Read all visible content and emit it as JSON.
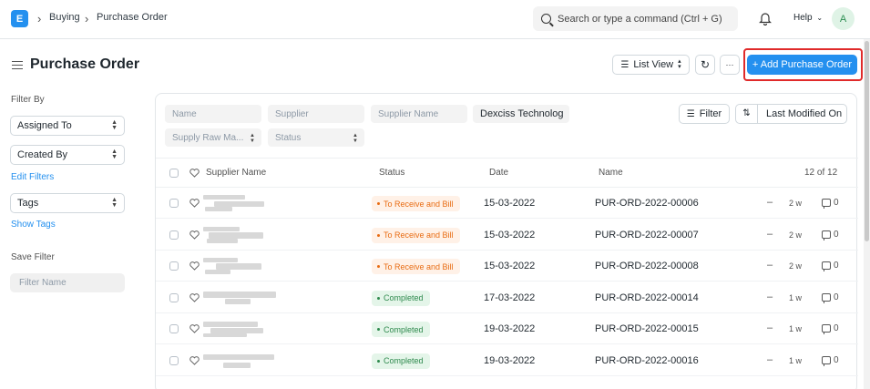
{
  "navbar": {
    "logo": "E",
    "breadcrumbs": [
      "Buying",
      "Purchase Order"
    ],
    "search_placeholder": "Search or type a command (Ctrl + G)",
    "help_label": "Help",
    "avatar_initial": "A"
  },
  "page": {
    "title": "Purchase Order",
    "view_label": "List View",
    "more_label": "···",
    "add_label": "+ Add Purchase Order"
  },
  "sidebar": {
    "filter_by_label": "Filter By",
    "assigned_to": "Assigned To",
    "created_by": "Created By",
    "edit_filters": "Edit Filters",
    "tags": "Tags",
    "show_tags": "Show Tags",
    "save_filter_label": "Save Filter",
    "filter_name_placeholder": "Filter Name"
  },
  "filters": {
    "name_placeholder": "Name",
    "supplier_placeholder": "Supplier",
    "supplier_name_placeholder": "Supplier Name",
    "company_value": "Dexciss Technolog",
    "supply_raw_placeholder": "Supply Raw Ma...",
    "status_placeholder": "Status",
    "filter_button": "Filter",
    "sort_label": "Last Modified On"
  },
  "list": {
    "headers": {
      "supplier_name": "Supplier Name",
      "status": "Status",
      "date": "Date",
      "name": "Name",
      "count": "12 of 12"
    },
    "rows": [
      {
        "status": "To Receive and Bill",
        "date": "15-03-2022",
        "name": "PUR-ORD-2022-00006",
        "dash": "–",
        "age": "2 w",
        "comments": "0"
      },
      {
        "status": "To Receive and Bill",
        "date": "15-03-2022",
        "name": "PUR-ORD-2022-00007",
        "dash": "–",
        "age": "2 w",
        "comments": "0"
      },
      {
        "status": "To Receive and Bill",
        "date": "15-03-2022",
        "name": "PUR-ORD-2022-00008",
        "dash": "–",
        "age": "2 w",
        "comments": "0"
      },
      {
        "status": "Completed",
        "date": "17-03-2022",
        "name": "PUR-ORD-2022-00014",
        "dash": "–",
        "age": "1 w",
        "comments": "0"
      },
      {
        "status": "Completed",
        "date": "19-03-2022",
        "name": "PUR-ORD-2022-00015",
        "dash": "–",
        "age": "1 w",
        "comments": "0"
      },
      {
        "status": "Completed",
        "date": "19-03-2022",
        "name": "PUR-ORD-2022-00016",
        "dash": "–",
        "age": "1 w",
        "comments": "0"
      }
    ]
  },
  "colors": {
    "primary": "#2490ef",
    "status_orange": "#e86c13",
    "status_green": "#2f8a4e",
    "highlight_red": "#e02a2a"
  }
}
